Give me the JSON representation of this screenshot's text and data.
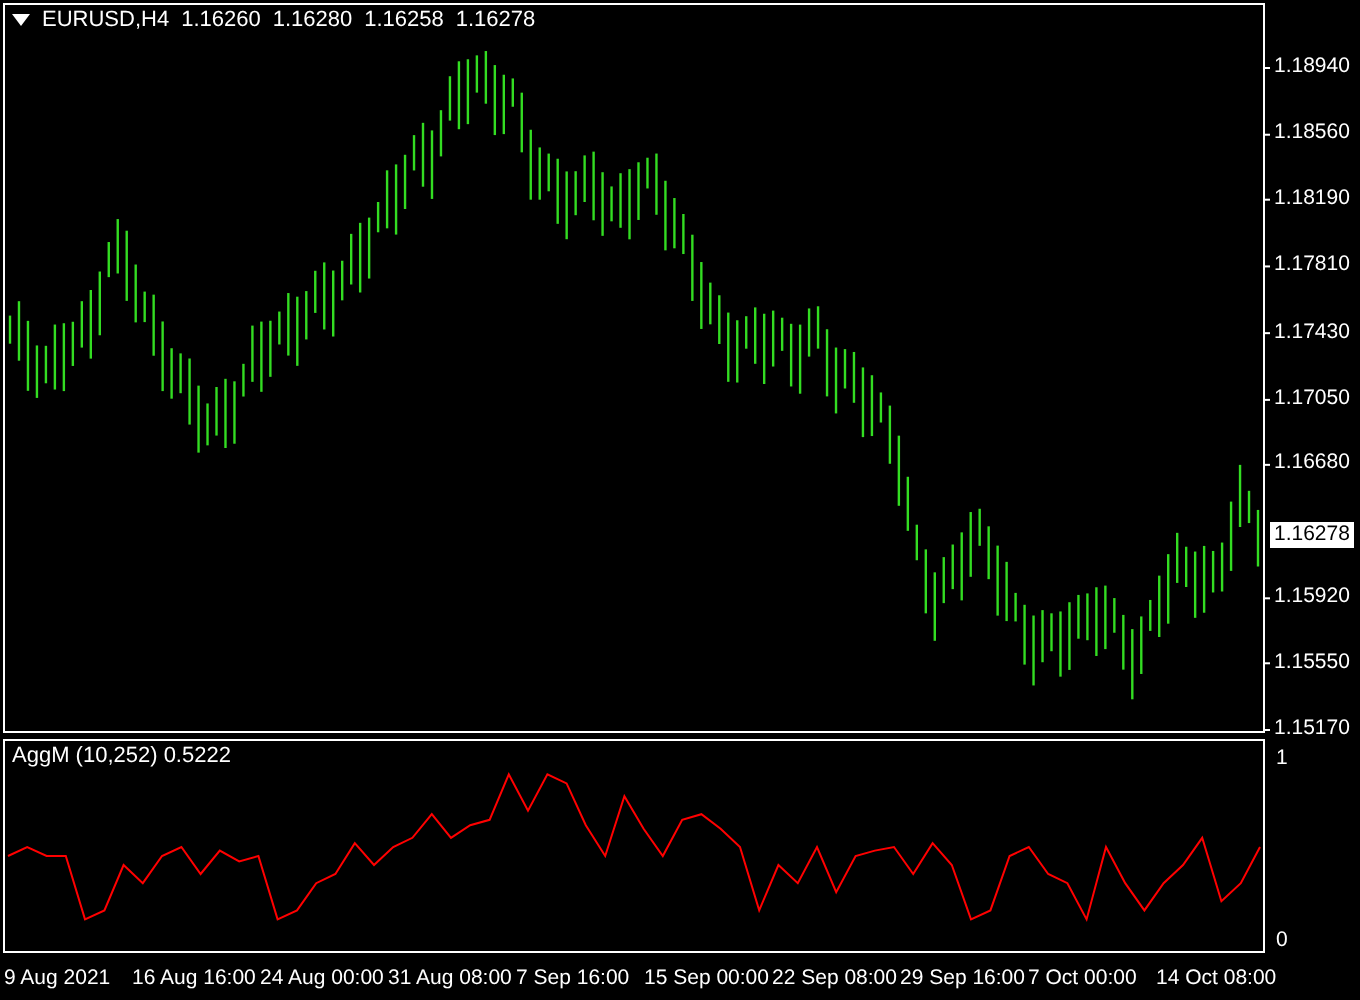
{
  "header": {
    "symbol": "EURUSD,H4",
    "quotes": [
      "1.16260",
      "1.16280",
      "1.16258",
      "1.16278"
    ]
  },
  "price_axis": [
    "1.18940",
    "1.18560",
    "1.18190",
    "1.17810",
    "1.17430",
    "1.17050",
    "1.16680",
    "1.15920",
    "1.15550",
    "1.15170"
  ],
  "current_price": "1.16278",
  "indicator": {
    "title": "AggM (10,252) 0.5222",
    "chart_data": {
      "type": "line",
      "ylim": [
        -0.08,
        1.09
      ],
      "yticks": [
        {
          "value": 1,
          "label": "1"
        },
        {
          "value": 0,
          "label": "0"
        }
      ],
      "series": [
        {
          "color": "#ff0000",
          "values": [
            0.45,
            0.5,
            0.45,
            0.45,
            0.1,
            0.15,
            0.4,
            0.3,
            0.45,
            0.5,
            0.35,
            0.48,
            0.42,
            0.45,
            0.1,
            0.15,
            0.3,
            0.35,
            0.52,
            0.4,
            0.5,
            0.55,
            0.68,
            0.55,
            0.62,
            0.65,
            0.9,
            0.7,
            0.9,
            0.85,
            0.62,
            0.45,
            0.78,
            0.6,
            0.45,
            0.65,
            0.68,
            0.6,
            0.5,
            0.15,
            0.4,
            0.3,
            0.5,
            0.25,
            0.45,
            0.48,
            0.5,
            0.35,
            0.52,
            0.4,
            0.1,
            0.15,
            0.45,
            0.5,
            0.35,
            0.3,
            0.1,
            0.5,
            0.3,
            0.15,
            0.3,
            0.4,
            0.55,
            0.2,
            0.3,
            0.5
          ]
        }
      ]
    }
  },
  "time_axis": [
    "9 Aug 2021",
    "16 Aug 16:00",
    "24 Aug 00:00",
    "31 Aug 08:00",
    "7 Sep 16:00",
    "15 Sep 00:00",
    "22 Sep 08:00",
    "29 Sep 16:00",
    "7 Oct 00:00",
    "14 Oct 08:00"
  ]
}
